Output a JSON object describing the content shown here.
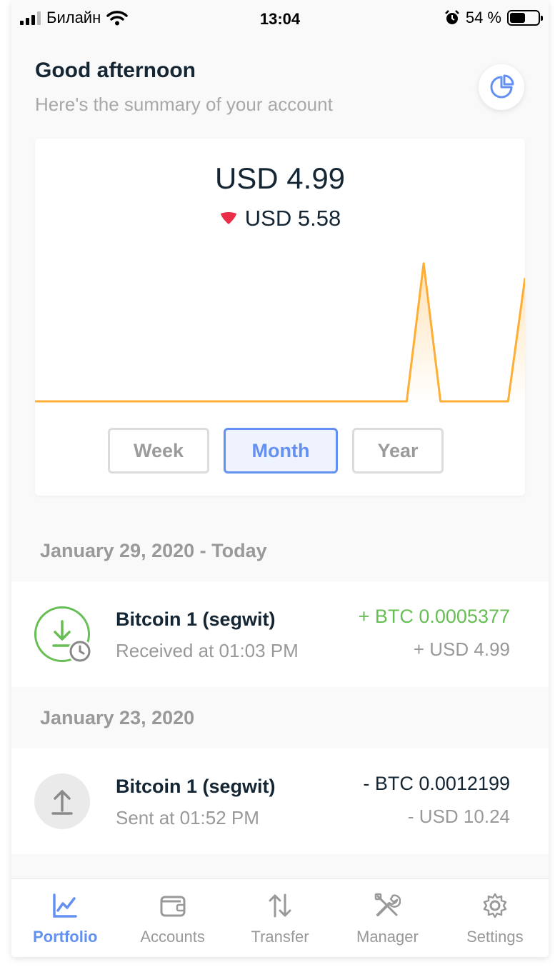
{
  "status_bar": {
    "carrier": "Билайн",
    "time": "13:04",
    "battery": "54 %",
    "battery_level": 0.54
  },
  "header": {
    "greeting": "Good afternoon",
    "subtitle": "Here's the summary of your account",
    "pie_icon": "pie-chart-icon"
  },
  "summary": {
    "balance": "USD 4.99",
    "change": "USD 5.58",
    "change_direction": "down",
    "change_color": "#ea2e49"
  },
  "chart_data": {
    "type": "area",
    "x": [
      0,
      1,
      2,
      3,
      4,
      5,
      6,
      7,
      8,
      9,
      10,
      11,
      12,
      13,
      14,
      15,
      16,
      17,
      18,
      19,
      20,
      21,
      22,
      23,
      24,
      25,
      26,
      27,
      28,
      29
    ],
    "series": [
      {
        "values": [
          0,
          0,
          0,
          0,
          0,
          0,
          0,
          0,
          0,
          0,
          0,
          0,
          0,
          0,
          0,
          0,
          0,
          0,
          0,
          0,
          0,
          0,
          0,
          5.58,
          0,
          0,
          0,
          0,
          0,
          4.99
        ],
        "color": "#ffae35"
      }
    ],
    "ylim": [
      0,
      5.6
    ],
    "grid": false
  },
  "range_selector": {
    "options": [
      "Week",
      "Month",
      "Year"
    ],
    "selected": "Month"
  },
  "operations": [
    {
      "date": "January 29, 2020 - Today",
      "account": "Bitcoin 1 (segwit)",
      "detail": "Received at 01:03 PM",
      "crypto_amount": "+ BTC 0.0005377",
      "fiat_amount": "+ USD 4.99",
      "type": "received",
      "icon": "receive-pending-icon",
      "color": "#66be54"
    },
    {
      "date": "January 23, 2020",
      "account": "Bitcoin 1 (segwit)",
      "detail": "Sent at 01:52 PM",
      "crypto_amount": "- BTC 0.0012199",
      "fiat_amount": "- USD 10.24",
      "type": "sent",
      "icon": "send-icon",
      "color": "#142533"
    }
  ],
  "nav": {
    "items": [
      {
        "label": "Portfolio",
        "icon": "portfolio-chart-icon",
        "active": true
      },
      {
        "label": "Accounts",
        "icon": "wallet-icon",
        "active": false
      },
      {
        "label": "Transfer",
        "icon": "transfer-arrows-icon",
        "active": false
      },
      {
        "label": "Manager",
        "icon": "tools-icon",
        "active": false
      },
      {
        "label": "Settings",
        "icon": "gear-icon",
        "active": false
      }
    ],
    "active_color": "#6490f1"
  },
  "colors": {
    "accent": "#6490f1",
    "positive": "#66be54",
    "negative": "#ea2e49",
    "chart_line": "#ffae35"
  }
}
